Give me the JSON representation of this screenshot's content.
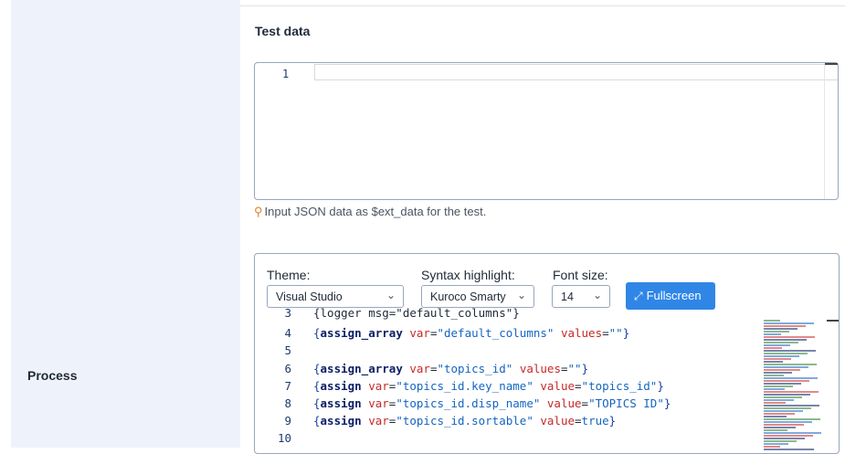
{
  "left": {
    "process_label": "Process"
  },
  "test_data": {
    "title": "Test data",
    "line_number": "1",
    "hint": "Input JSON data as $ext_data for the test."
  },
  "editor": {
    "theme": {
      "label": "Theme:",
      "value": "Visual Studio"
    },
    "syntax": {
      "label": "Syntax highlight:",
      "value": "Kuroco Smarty"
    },
    "font_size": {
      "label": "Font size:",
      "value": "14"
    },
    "fullscreen_label": "Fullscreen",
    "lines": [
      {
        "n": "3",
        "text": "{logger msg=\"default_columns\"}"
      },
      {
        "n": "4",
        "text": "{assign_array var=\"default_columns\" values=\"\"}"
      },
      {
        "n": "5",
        "text": ""
      },
      {
        "n": "6",
        "text": "{assign_array var=\"topics_id\" values=\"\"}"
      },
      {
        "n": "7",
        "text": "{assign var=\"topics_id.key_name\" value=\"topics_id\"}"
      },
      {
        "n": "8",
        "text": "{assign var=\"topics_id.disp_name\" value=\"TOPICS ID\"}"
      },
      {
        "n": "9",
        "text": "{assign var=\"topics_id.sortable\" value=true}"
      },
      {
        "n": "10",
        "text": ""
      }
    ]
  },
  "colors": {
    "accent": "#2f86e6",
    "sidebar_bg": "#eef3fb",
    "keyword": "#0b1f66",
    "attr": "#c62828",
    "string": "#1565c0"
  },
  "icons": {
    "hint": "lightbulb-icon",
    "fullscreen": "expand-icon",
    "dropdown": "chevron-down-icon"
  }
}
